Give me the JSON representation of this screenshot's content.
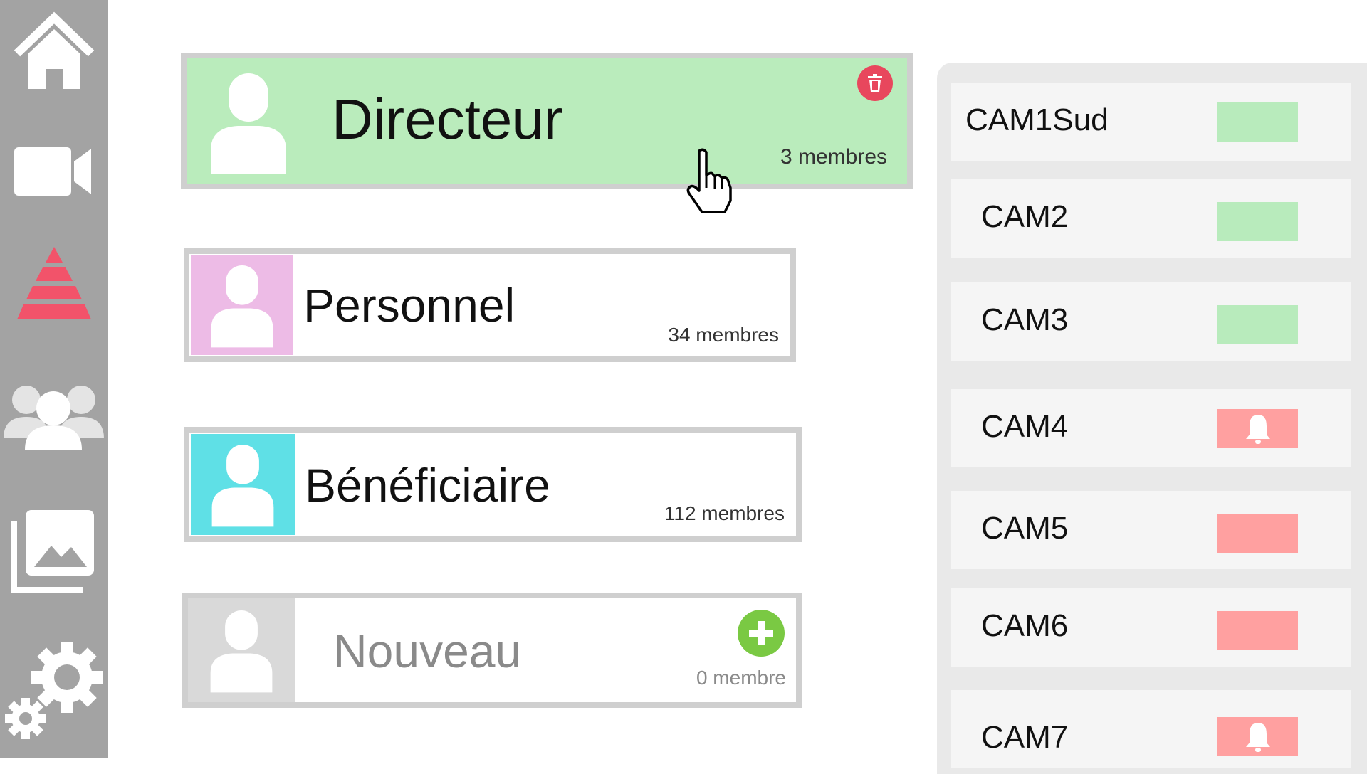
{
  "sidebar": {
    "items": [
      {
        "icon": "home-icon"
      },
      {
        "icon": "video-camera-icon"
      },
      {
        "icon": "hierarchy-pyramid-icon"
      },
      {
        "icon": "users-group-icon"
      },
      {
        "icon": "gallery-icon"
      },
      {
        "icon": "settings-gears-icon"
      }
    ]
  },
  "groups": [
    {
      "name": "Directeur",
      "count": "3 membres",
      "color": "#baecbc"
    },
    {
      "name": "Personnel",
      "count": "34 membres",
      "color": "#edbbe6"
    },
    {
      "name": "Bénéficiaire",
      "count": "112 membres",
      "color": "#5fe0e6"
    },
    {
      "name": "Nouveau",
      "count": "0 membre",
      "color": "#d9d9d9"
    }
  ],
  "cameras": [
    {
      "label": "CAM1Sud",
      "status": "ok"
    },
    {
      "label": "CAM2",
      "status": "ok"
    },
    {
      "label": "CAM3",
      "status": "ok"
    },
    {
      "label": "CAM4",
      "status": "alert",
      "icon": "bell-icon"
    },
    {
      "label": "CAM5",
      "status": "alert"
    },
    {
      "label": "CAM6",
      "status": "alert"
    },
    {
      "label": "CAM7",
      "status": "alert",
      "icon": "bell-icon"
    }
  ],
  "colors": {
    "sidebar": "#a3a3a3",
    "ok": "#b8ebbc",
    "alert": "#ffa0a0",
    "delete": "#e8475d",
    "add": "#7ac943"
  }
}
